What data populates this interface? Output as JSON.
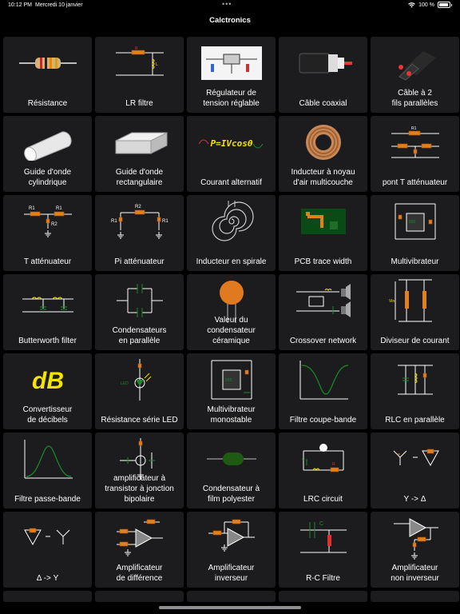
{
  "status": {
    "time": "10:12 PM",
    "date": "Mercredi 10 janvier",
    "battery": "100 %"
  },
  "app": {
    "title": "Calctronics"
  },
  "items": [
    {
      "label": "Résistance",
      "icon": "resistor-icon"
    },
    {
      "label": "LR filtre",
      "icon": "lr-filter-icon"
    },
    {
      "label": "Régulateur de\ntension réglable",
      "icon": "voltage-regulator-icon"
    },
    {
      "label": "Câble coaxial",
      "icon": "coax-cable-icon"
    },
    {
      "label": "Câble à 2\nfils parallèles",
      "icon": "twin-lead-cable-icon"
    },
    {
      "label": "Guide d'onde\ncylindrique",
      "icon": "cylindrical-waveguide-icon"
    },
    {
      "label": "Guide d'onde\nrectangulaire",
      "icon": "rectangular-waveguide-icon"
    },
    {
      "label": "Courant alternatif",
      "icon": "ac-power-icon",
      "icon_text": "P=IVcosθ"
    },
    {
      "label": "Inducteur à noyau\nd'air multicouche",
      "icon": "air-core-inductor-icon"
    },
    {
      "label": "pont T atténuateur",
      "icon": "bridged-t-attenuator-icon"
    },
    {
      "label": "T atténuateur",
      "icon": "t-attenuator-icon"
    },
    {
      "label": "Pi atténuateur",
      "icon": "pi-attenuator-icon"
    },
    {
      "label": "Inducteur en spirale",
      "icon": "spiral-inductor-icon"
    },
    {
      "label": "PCB trace width",
      "icon": "pcb-trace-icon"
    },
    {
      "label": "Multivibrateur",
      "icon": "multivibrator-icon"
    },
    {
      "label": "Butterworth filter",
      "icon": "butterworth-filter-icon"
    },
    {
      "label": "Condensateurs\nen parallèle",
      "icon": "parallel-capacitors-icon"
    },
    {
      "label": "Valeur du\ncondensateur\ncéramique",
      "icon": "ceramic-capacitor-icon"
    },
    {
      "label": "Crossover network",
      "icon": "crossover-network-icon"
    },
    {
      "label": "Diviseur de courant",
      "icon": "current-divider-icon"
    },
    {
      "label": "Convertisseur\nde décibels",
      "icon": "decibel-icon",
      "icon_text": "dB"
    },
    {
      "label": "Résistance série LED",
      "icon": "led-resistor-icon"
    },
    {
      "label": "Multivibrateur\nmonostable",
      "icon": "monostable-icon"
    },
    {
      "label": "Filtre coupe-bande",
      "icon": "band-stop-icon"
    },
    {
      "label": "RLC en parallèle",
      "icon": "parallel-rlc-icon"
    },
    {
      "label": "Filtre passe-bande",
      "icon": "band-pass-icon"
    },
    {
      "label": "amplificateur à\ntransistor à jonction\nbipolaire",
      "icon": "bjt-amplifier-icon"
    },
    {
      "label": "Condensateur à\nfilm polyester",
      "icon": "film-capacitor-icon"
    },
    {
      "label": "LRC circuit",
      "icon": "lrc-circuit-icon"
    },
    {
      "label": "Y -> Δ",
      "icon": "wye-delta-icon"
    },
    {
      "label": "Δ -> Y",
      "icon": "delta-wye-icon"
    },
    {
      "label": "Amplificateur\nde différence",
      "icon": "difference-amp-icon"
    },
    {
      "label": "Amplificateur\ninverseur",
      "icon": "inverting-amp-icon"
    },
    {
      "label": "R-C Filtre",
      "icon": "rc-filter-icon"
    },
    {
      "label": "Amplificateur\nnon inverseur",
      "icon": "non-inverting-amp-icon"
    }
  ],
  "colors": {
    "background": "#000000",
    "cell": "#1c1c1e",
    "text": "#ffffff",
    "wire": "#ffffff",
    "accent_green": "#1a8c2a",
    "accent_yellow": "#f5e400",
    "accent_red": "#e03030"
  }
}
